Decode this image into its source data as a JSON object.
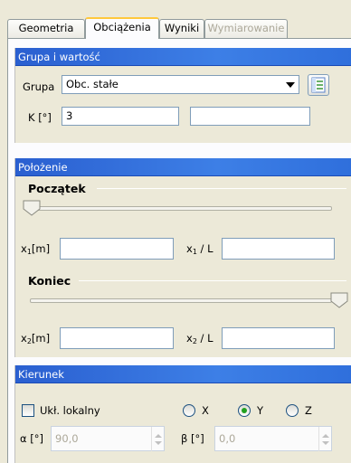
{
  "tabs": [
    {
      "label": "Geometria"
    },
    {
      "label": "Obciążenia"
    },
    {
      "label": "Wyniki"
    },
    {
      "label": "Wymiarowanie"
    }
  ],
  "group_panel": {
    "title": "Grupa i wartość",
    "group_label": "Grupa",
    "group_value": "Obc. stałe",
    "k_label": "K [°]",
    "k_value": "3",
    "k_value2": ""
  },
  "position_panel": {
    "title": "Położenie",
    "start_title": "Początek",
    "start_slider_fraction": 0,
    "x1_label_main": "x",
    "x1_sub": "1",
    "x1_unit": "[m]",
    "x1_value": "",
    "x1L_label_main": "x",
    "x1L_sub": "1",
    "x1L_unit": " / L",
    "x1L_value": "",
    "end_title": "Koniec",
    "end_slider_fraction": 1,
    "x2_label_main": "x",
    "x2_sub": "2",
    "x2_unit": "[m]",
    "x2_value": "",
    "x2L_label_main": "x",
    "x2L_sub": "2",
    "x2L_unit": " / L",
    "x2L_value": ""
  },
  "direction_panel": {
    "title": "Kierunek",
    "local_label": "Ukł. lokalny",
    "local_checked": false,
    "radio_x": "X",
    "radio_y": "Y",
    "radio_z": "Z",
    "selected_axis": "Y",
    "alpha_label": "α [°]",
    "alpha_value": "90,0",
    "beta_label": "β [°]",
    "beta_value": "0,0"
  },
  "colors": {
    "panel_header": "#3d7fe6",
    "active_tab_accent": "#ffc83c",
    "radio_dot": "#21a121"
  }
}
